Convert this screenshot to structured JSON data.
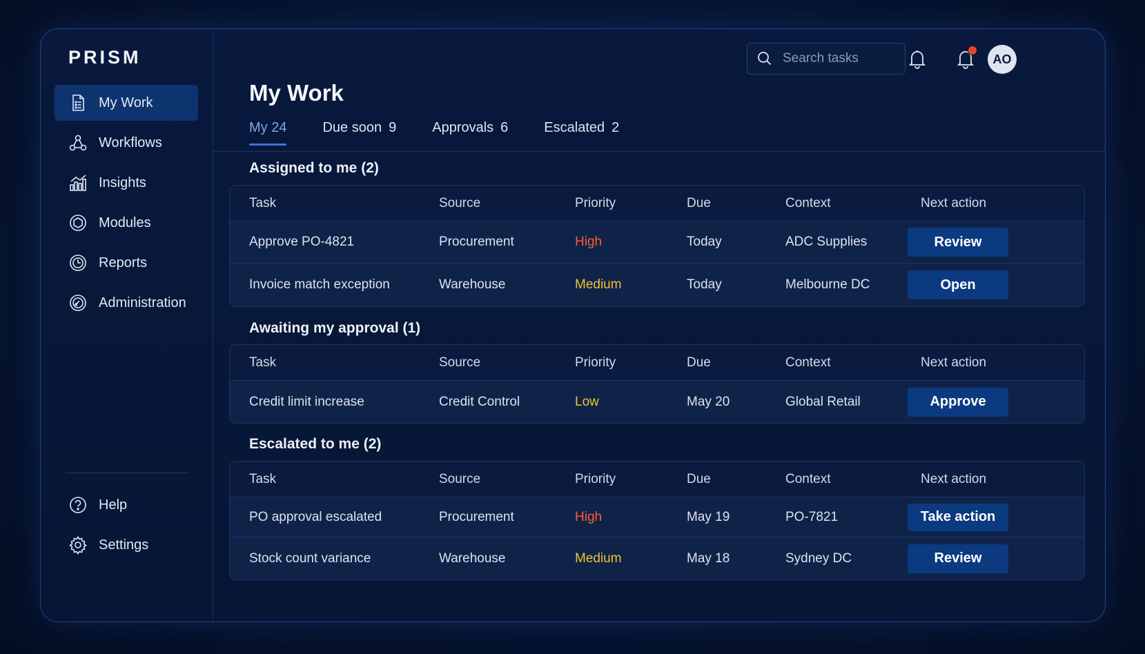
{
  "app": {
    "name": "PRISM"
  },
  "sidebar": {
    "items": [
      {
        "label": "My Work",
        "icon": "document-list-icon",
        "active": true
      },
      {
        "label": "Workflows",
        "icon": "workflow-nodes-icon"
      },
      {
        "label": "Insights",
        "icon": "bar-chart-icon"
      },
      {
        "label": "Modules",
        "icon": "module-hexagon-icon"
      },
      {
        "label": "Reports",
        "icon": "clock-report-icon"
      },
      {
        "label": "Administration",
        "icon": "admin-compass-icon"
      }
    ],
    "bottom_items": [
      {
        "label": "Help",
        "icon": "help-circle-icon"
      },
      {
        "label": "Settings",
        "icon": "gear-icon"
      }
    ]
  },
  "header": {
    "search_placeholder": "Search tasks",
    "avatar_initials": "AO"
  },
  "page": {
    "title": "My Work",
    "tabs": [
      {
        "label": "My",
        "count": "24",
        "active": true
      },
      {
        "label": "Due soon",
        "count": "9"
      },
      {
        "label": "Approvals",
        "count": "6"
      },
      {
        "label": "Escalated",
        "count": "2"
      }
    ]
  },
  "columns": [
    "Task",
    "Source",
    "Priority",
    "Due",
    "Context",
    "Next action"
  ],
  "sections": [
    {
      "title": "Assigned to me (2)",
      "rows": [
        {
          "task": "Approve PO-4821",
          "source": "Procurement",
          "priority": "High",
          "due": "Today",
          "context": "ADC Supplies",
          "action": "Review"
        },
        {
          "task": "Invoice match exception",
          "source": "Warehouse",
          "priority": "Medium",
          "due": "Today",
          "context": "Melbourne DC",
          "action": "Open"
        }
      ]
    },
    {
      "title": "Awaiting my approval (1)",
      "rows": [
        {
          "task": "Credit limit increase",
          "source": "Credit Control",
          "priority": "Low",
          "due": "May 20",
          "context": "Global Retail",
          "action": "Approve"
        }
      ]
    },
    {
      "title": "Escalated to me (2)",
      "rows": [
        {
          "task": "PO approval escalated",
          "source": "Procurement",
          "priority": "High",
          "due": "May 19",
          "context": "PO-7821",
          "action": "Take action"
        },
        {
          "task": "Stock count variance",
          "source": "Warehouse",
          "priority": "Medium",
          "due": "May 18",
          "context": "Sydney DC",
          "action": "Review"
        }
      ]
    }
  ],
  "colors": {
    "accent": "#3d74d4",
    "button": "#0b3a80",
    "high": "#ff5a36",
    "medium": "#f2c230",
    "low": "#f2c230"
  }
}
